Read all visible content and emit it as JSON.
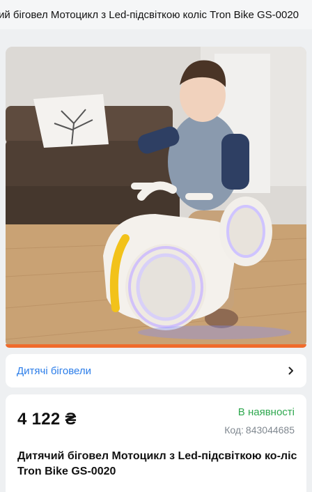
{
  "header": {
    "title": "ий біговел Мотоцикл з Led-підсвіткою коліс Tron Bike GS-0020"
  },
  "category": {
    "label": "Дитячі біговели"
  },
  "product": {
    "price": "4 122 ₴",
    "stock_status": "В наявності",
    "code_label": "Код:",
    "code_value": "843044685",
    "name": "Дитячий біговел Мотоцикл з Led-підсвіткою ко-ліс Tron Bike GS-0020"
  },
  "colors": {
    "accent_link": "#2b7de9",
    "in_stock": "#2fa84f",
    "image_progress": "#f06b2c"
  },
  "icons": {
    "category_chevron": "chevron-right-icon"
  }
}
